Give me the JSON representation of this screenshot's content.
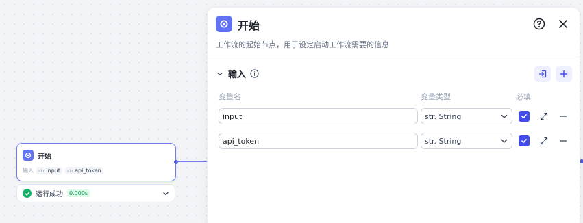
{
  "node": {
    "title": "开始",
    "input_label": "输入",
    "vars": [
      {
        "type": "str",
        "name": "input"
      },
      {
        "type": "str",
        "name": "api_token"
      }
    ],
    "icon": "workflow-start-icon"
  },
  "run_status": {
    "text": "运行成功",
    "time": "0.000s",
    "icon": "check-circle-icon"
  },
  "panel": {
    "title": "开始",
    "description": "工作流的起始节点，用于设定启动工作流需要的信息",
    "section_title": "输入",
    "columns": {
      "name": "变量名",
      "type": "变量类型",
      "required": "必填"
    },
    "rows": [
      {
        "name": "input",
        "type": "str. String",
        "required": true
      },
      {
        "name": "api_token",
        "type": "str. String",
        "required": true
      }
    ]
  },
  "colors": {
    "accent": "#444ce7",
    "node_icon": "#6172f3",
    "success": "#17b26a"
  }
}
